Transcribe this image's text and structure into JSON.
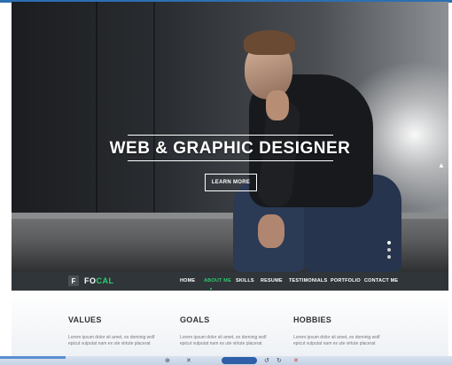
{
  "hero": {
    "title": "WEB & GRAPHIC DESIGNER",
    "button_label": "LEARN MORE",
    "slide_indicator": {
      "count": 3,
      "active_index": 0
    }
  },
  "navbar": {
    "logo_mark": "F",
    "logo_text_a": "FO",
    "logo_text_b": "CAL",
    "items": [
      {
        "label": "HOME",
        "active": false
      },
      {
        "label": "ABOUT ME",
        "active": true
      },
      {
        "label": "SKILLS",
        "active": false
      },
      {
        "label": "RESUME",
        "active": false
      },
      {
        "label": "TESTIMONIALS",
        "active": false
      },
      {
        "label": "PORTFOLIO",
        "active": false
      },
      {
        "label": "CONTACT ME",
        "active": false
      }
    ]
  },
  "sections": [
    {
      "title": "VALUES",
      "text": "Lorem ipsum dolor sit amet, ex dominig wolf epicut vulputat nam ex ute virtute placerat"
    },
    {
      "title": "GOALS",
      "text": "Lorem ipsum dolor sit amet, ex dominig wolf epicut vulputat nam ex ute virtute placerat"
    },
    {
      "title": "HOBBIES",
      "text": "Lorem ipsum dolor sit amet, ex dominig wolf epicut vulputat nam ex ute virtute placerat"
    }
  ],
  "player": {
    "progress": 0.145,
    "icons": [
      "zoom-icon",
      "close-icon",
      "play-pause-icon",
      "rewind-icon",
      "redo-icon",
      "stop-icon"
    ]
  },
  "colors": {
    "accent": "#2ecc71",
    "navbar_bg": "#2f3538",
    "player_bar": "#c6d2e4"
  }
}
